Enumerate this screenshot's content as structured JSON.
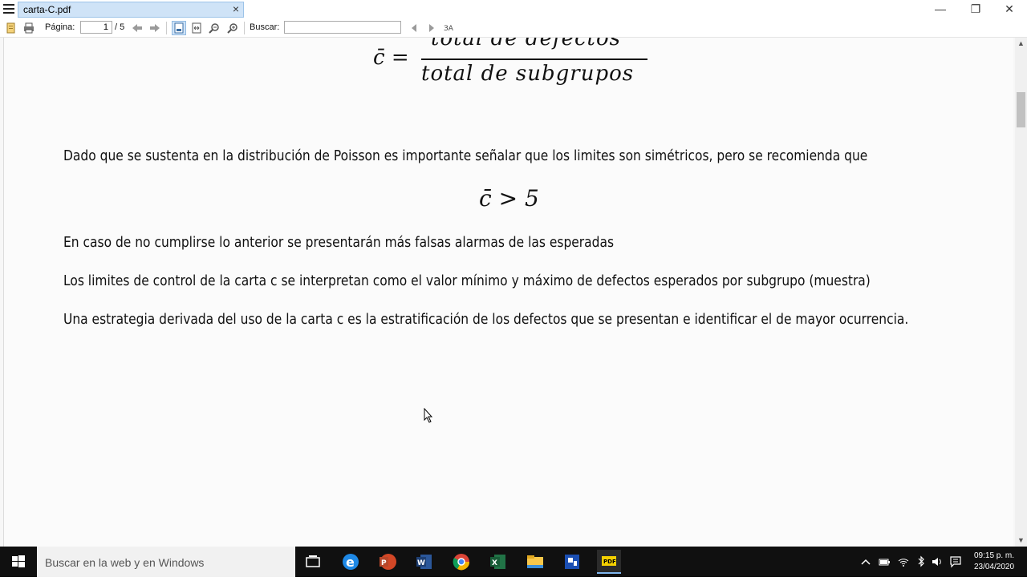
{
  "window": {
    "tab_title": "carta-C.pdf",
    "tab_close_glyph": "×",
    "minimize_glyph": "—",
    "maximize_glyph": "❐",
    "close_glyph": "✕"
  },
  "toolbar": {
    "page_label": "Página:",
    "page_value": "1",
    "page_total": "/ 5",
    "search_label": "Buscar:",
    "search_value": "",
    "icons": [
      "document-icon",
      "print-icon",
      "previous-page-icon",
      "next-page-icon",
      "fit-page-icon",
      "fit-width-icon",
      "zoom-out-icon",
      "zoom-in-icon",
      "search-prev-icon",
      "search-next-icon",
      "text-options-icon"
    ]
  },
  "document": {
    "formula_lhs": "c̄ =",
    "formula_numerator": "total de defectos",
    "formula_denominator": "total de subgrupos",
    "paragraph_1": "Dado que se sustenta en la distribución de Poisson es importante señalar que los limites son simétricos, pero se recomienda que",
    "inequality": "c̄ > 5",
    "paragraph_2": " En caso de no cumplirse lo anterior se presentarán más falsas alarmas de las esperadas",
    "paragraph_3": "Los limites de control de la carta c se interpretan como el valor mínimo y máximo de defectos esperados por subgrupo (muestra)",
    "paragraph_4": "Una estrategia derivada del uso de la carta c es la estratificación de los defectos que se presentan e identificar el de mayor ocurrencia."
  },
  "taskbar": {
    "search_placeholder": "Buscar en la web y en Windows",
    "apps": [
      "task-view-icon",
      "edge-icon",
      "powerpoint-icon",
      "word-icon",
      "chrome-icon",
      "excel-icon",
      "file-explorer-icon",
      "app-icon",
      "pdf-reader-icon"
    ],
    "tray_icons": [
      "show-hidden-icon",
      "battery-icon",
      "wifi-icon",
      "bluetooth-icon",
      "volume-icon",
      "notification-icon"
    ],
    "time": "09:15 p. m.",
    "date": "23/04/2020"
  },
  "colors": {
    "tab_active": "#cfe3f7",
    "taskbar": "#101010",
    "page_background": "#fbfbfb"
  }
}
